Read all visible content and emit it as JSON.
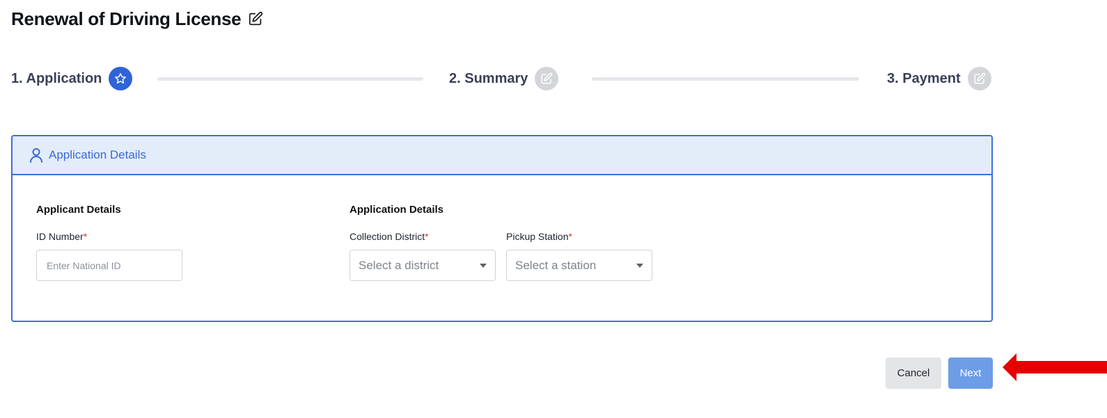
{
  "page": {
    "title": "Renewal of Driving License",
    "title_icon": "edit-icon"
  },
  "stepper": {
    "steps": [
      {
        "label": "1. Application",
        "icon": "star-icon",
        "state": "active"
      },
      {
        "label": "2. Summary",
        "icon": "edit-icon",
        "state": "inactive"
      },
      {
        "label": "3. Payment",
        "icon": "edit-icon",
        "state": "inactive"
      }
    ]
  },
  "card": {
    "header_title": "Application Details",
    "header_icon": "user-icon",
    "applicant_section": {
      "title": "Applicant Details",
      "id_label": "ID Number",
      "required_mark": "*",
      "id_placeholder": "Enter National ID",
      "id_value": ""
    },
    "application_section": {
      "title": "Application Details",
      "district_label": "Collection District",
      "district_placeholder": "Select a district",
      "station_label": "Pickup Station",
      "station_placeholder": "Select a station",
      "required_mark": "*"
    }
  },
  "actions": {
    "cancel_label": "Cancel",
    "next_label": "Next"
  },
  "colors": {
    "primary": "#2f63d6",
    "card_border": "#3d6fd9",
    "card_header_bg": "#e3ecf9",
    "next_button": "#6d9de6",
    "required": "#d93838",
    "annotation_arrow": "#e60000"
  }
}
